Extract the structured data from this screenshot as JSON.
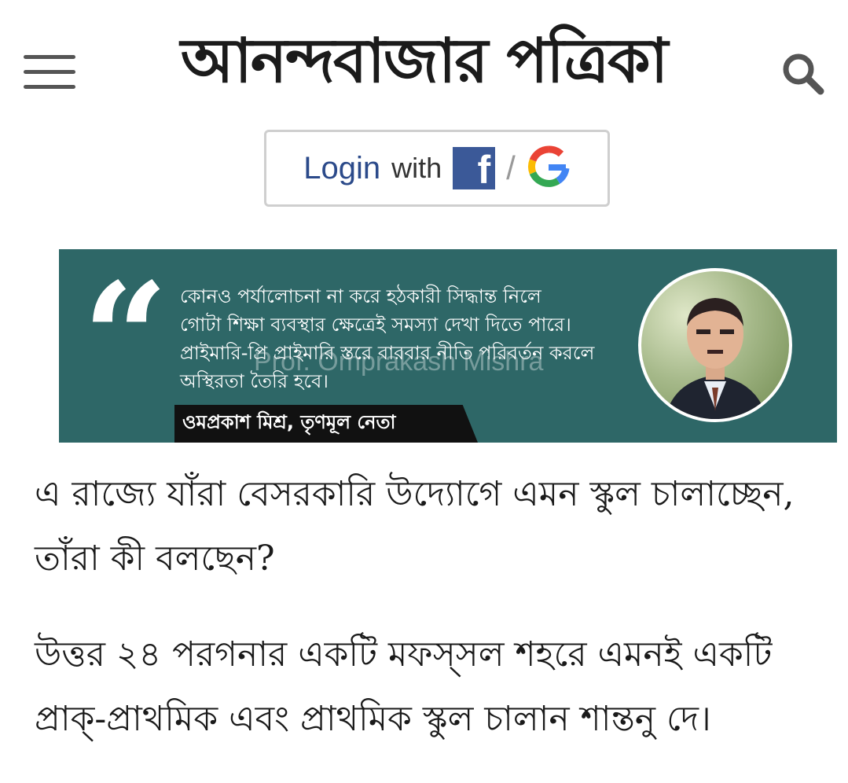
{
  "header": {
    "masthead": "আনন্দবাজার পত্রিকা",
    "menu_icon": "hamburger-menu-icon",
    "search_icon": "search-icon"
  },
  "login": {
    "login_label": "Login",
    "with_label": "with",
    "fb_letter": "f",
    "separator": "/",
    "facebook_icon": "facebook-icon",
    "google_icon": "google-icon"
  },
  "quote_banner": {
    "quote_mark": "“",
    "lines": [
      "কোনও পর্যালোচনা না করে হঠকারী সিদ্ধান্ত নিলে",
      "গোটা শিক্ষা ব্যবস্থার ক্ষেত্রেই সমস্যা দেখা দিতে পারে।",
      "প্রাইমারি-প্রি প্রাইমারি স্তরে বারবার নীতি পরিবর্তন করলে",
      "অস্থিরতা তৈরি হবে।"
    ],
    "watermark": "Prof. Omprakash Mishra",
    "attribution": "ওমপ্রকাশ মিশ্র, তৃণমূল নেতা",
    "bg_color": "#2e6767"
  },
  "article": {
    "paragraphs": [
      "এ রাজ্যে যাঁরা বেসরকারি উদ্যোগে এমন স্কুল চালাচ্ছেন, তাঁরা কী বলছেন?",
      "উত্তর ২৪ পরগনার একটি মফস্‌সল শহরে এমনই একটি প্রাক্‌-প্রাথমিক এবং প্রাথমিক স্কুল চালান শান্তনু দে।"
    ]
  }
}
